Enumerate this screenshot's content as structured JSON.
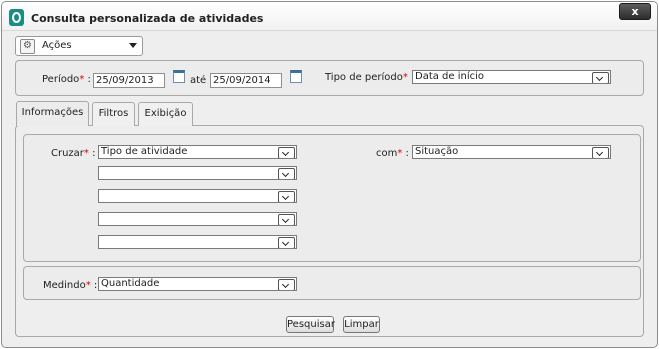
{
  "window": {
    "title": "Consulta personalizada de atividades",
    "close_label": "x"
  },
  "actions": {
    "label": "Ações"
  },
  "period": {
    "label": "Período",
    "required": "*",
    "separator": ":",
    "start": "25/09/2013",
    "until_label": "até",
    "end": "25/09/2014",
    "type_label": "Tipo de período",
    "type_value": "Data de início"
  },
  "tabs": [
    {
      "label": "Informações",
      "active": true
    },
    {
      "label": "Filtros"
    },
    {
      "label": "Exibição"
    }
  ],
  "cross": {
    "label": "Cruzar",
    "required": "*",
    "separator": ":",
    "selects": [
      "Tipo de atividade",
      "",
      "",
      "",
      ""
    ],
    "with_label": "com",
    "with_value": "Situação"
  },
  "measure": {
    "label": "Medindo",
    "required": "*",
    "separator": ":",
    "value": "Quantidade"
  },
  "buttons": {
    "search": "Pesquisar",
    "clear": "Limpar"
  },
  "colors": {
    "required": "#e00000",
    "app_icon": "#178e80",
    "close_button": "#2c2c2c"
  }
}
